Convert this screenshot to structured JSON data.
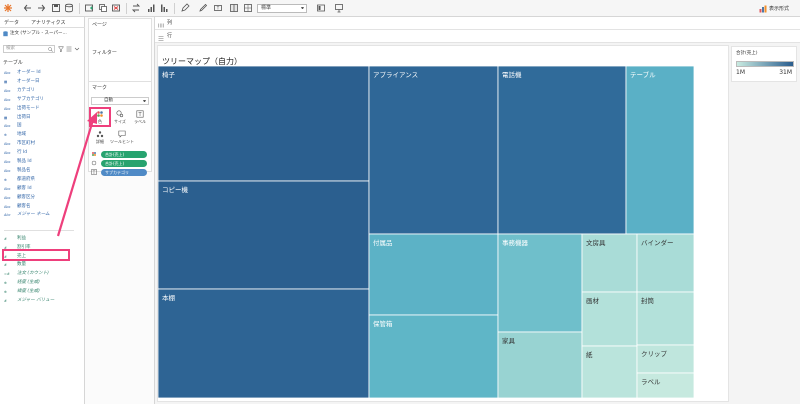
{
  "toolbar": {
    "fit_mode": "標準",
    "show_me_label": "表示形式"
  },
  "data_pane": {
    "tabs": [
      "データ",
      "アナリティクス"
    ],
    "data_source": "注文 (サンプル - スーパー...",
    "search_placeholder": "検索",
    "table_label": "テーブル",
    "fields": [
      {
        "type": "Abc",
        "name": "オーダー Id",
        "kind": "dim",
        "italic": false
      },
      {
        "type": "▦",
        "name": "オーダー日",
        "kind": "dim",
        "italic": false
      },
      {
        "type": "Abc",
        "name": "カテゴリ",
        "kind": "dim",
        "italic": false
      },
      {
        "type": "Abc",
        "name": "サブカテゴリ",
        "kind": "dim",
        "italic": false
      },
      {
        "type": "Abc",
        "name": "出荷モード",
        "kind": "dim",
        "italic": false
      },
      {
        "type": "▦",
        "name": "出荷日",
        "kind": "dim",
        "italic": false
      },
      {
        "type": "Abc",
        "name": "国",
        "kind": "dim",
        "italic": false
      },
      {
        "type": "⊕",
        "name": "地域",
        "kind": "dim",
        "italic": false
      },
      {
        "type": "Abc",
        "name": "市区町村",
        "kind": "dim",
        "italic": false
      },
      {
        "type": "Abc",
        "name": "行 Id",
        "kind": "dim",
        "italic": false
      },
      {
        "type": "Abc",
        "name": "製品 Id",
        "kind": "dim",
        "italic": false
      },
      {
        "type": "Abc",
        "name": "製品名",
        "kind": "dim",
        "italic": false
      },
      {
        "type": "⊕",
        "name": "都道府県",
        "kind": "dim",
        "italic": false
      },
      {
        "type": "Abc",
        "name": "顧客 Id",
        "kind": "dim",
        "italic": false
      },
      {
        "type": "Abc",
        "name": "顧客区分",
        "kind": "dim",
        "italic": false
      },
      {
        "type": "Abc",
        "name": "顧客名",
        "kind": "dim",
        "italic": false
      },
      {
        "type": "Abc",
        "name": "メジャー ネーム",
        "kind": "dim",
        "italic": true
      },
      {
        "type": "#",
        "name": "利益",
        "kind": "mea",
        "italic": false
      },
      {
        "type": "#",
        "name": "割引率",
        "kind": "mea",
        "italic": false
      },
      {
        "type": "#",
        "name": "売上",
        "kind": "mea",
        "italic": false
      },
      {
        "type": "#",
        "name": "数量",
        "kind": "mea",
        "italic": false
      },
      {
        "type": "=#",
        "name": "注文 (カウント)",
        "kind": "mea",
        "italic": true
      },
      {
        "type": "⊕",
        "name": "経度 (生成)",
        "kind": "mea",
        "italic": true
      },
      {
        "type": "⊕",
        "name": "緯度 (生成)",
        "kind": "mea",
        "italic": true
      },
      {
        "type": "#",
        "name": "メジャー バリュー",
        "kind": "mea",
        "italic": true
      }
    ]
  },
  "cards": {
    "pages": "ページ",
    "filters": "フィルター",
    "marks": "マーク",
    "mark_type": "自動",
    "mark_buttons": [
      "色",
      "サイズ",
      "ラベル",
      "詳細",
      "ツールヒント"
    ],
    "pills": [
      {
        "label": "合計(売上)",
        "color": "green"
      },
      {
        "label": "合計(売上)",
        "color": "green"
      },
      {
        "label": "サブカテゴリ",
        "color": "blue"
      }
    ]
  },
  "shelves": {
    "columns": "列",
    "rows": "行"
  },
  "sheet": {
    "title": "ツリーマップ（自力）"
  },
  "legend": {
    "title": "合計(売上)",
    "min": "1M",
    "max": "31M",
    "color_low": "#c9ebe1",
    "color_high": "#2a5d8e"
  },
  "treemap": {
    "tiles": [
      {
        "label": "椅子",
        "color": "#2b5f8f"
      },
      {
        "label": "コピー機",
        "color": "#2b5f8f"
      },
      {
        "label": "本棚",
        "color": "#2e6494"
      },
      {
        "label": "アプライアンス",
        "color": "#2f6797"
      },
      {
        "label": "電話機",
        "color": "#306b9a"
      },
      {
        "label": "テーブル",
        "color": "#5ab0c6"
      },
      {
        "label": "付属品",
        "color": "#5cb2c6"
      },
      {
        "label": "保管箱",
        "color": "#5fb6c7"
      },
      {
        "label": "事務機器",
        "color": "#6fbfcb"
      },
      {
        "label": "家具",
        "color": "#98d3d2"
      },
      {
        "label": "文房具",
        "color": "#a9dcd7"
      },
      {
        "label": "バインダー",
        "color": "#a9dcd7"
      },
      {
        "label": "画材",
        "color": "#b3e1da"
      },
      {
        "label": "封筒",
        "color": "#b3e1da"
      },
      {
        "label": "紙",
        "color": "#bae4dc"
      },
      {
        "label": "クリップ",
        "color": "#bfe6dd"
      },
      {
        "label": "ラベル",
        "color": "#c6e9df"
      }
    ]
  }
}
